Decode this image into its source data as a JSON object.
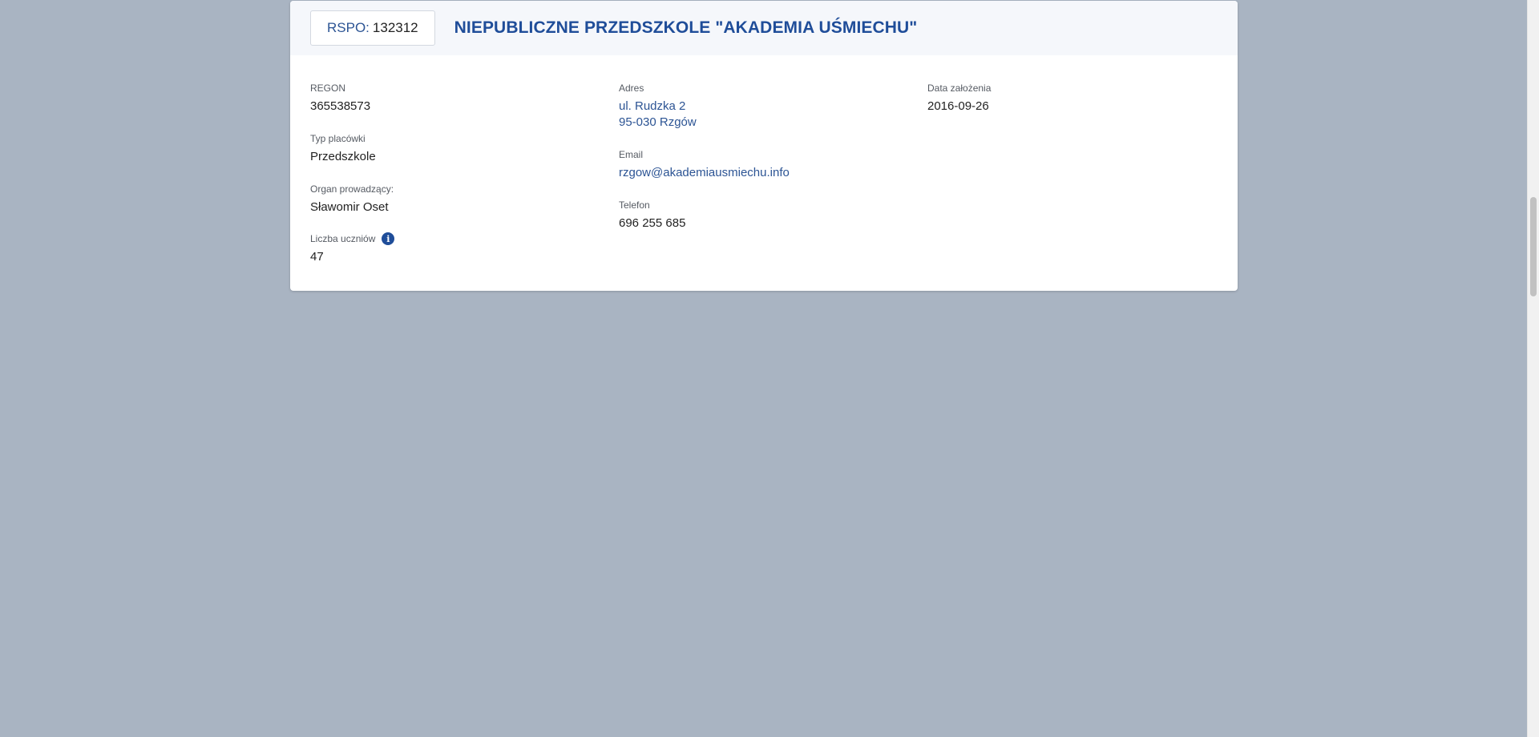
{
  "header": {
    "rspo_label": "RSPO:",
    "rspo_value": "132312",
    "school_name": "NIEPUBLICZNE PRZEDSZKOLE \"AKADEMIA UŚMIECHU\""
  },
  "fields": {
    "regon": {
      "label": "REGON",
      "value": "365538573"
    },
    "type": {
      "label": "Typ placówki",
      "value": "Przedszkole"
    },
    "organ": {
      "label": "Organ prowadzący:",
      "value": "Sławomir Oset"
    },
    "students": {
      "label": "Liczba uczniów",
      "value": "47",
      "icon": "info-icon"
    },
    "address": {
      "label": "Adres",
      "line1": "ul. Rudzka 2",
      "line2": "95-030 Rzgów"
    },
    "email": {
      "label": "Email",
      "value": "rzgow@akademiausmiechu.info"
    },
    "phone": {
      "label": "Telefon",
      "value": "696 255 685"
    },
    "founded": {
      "label": "Data założenia",
      "value": "2016-09-26"
    }
  },
  "colors": {
    "background": "#a9b4c2",
    "accent": "#1f4d99",
    "link": "#2c5494"
  }
}
